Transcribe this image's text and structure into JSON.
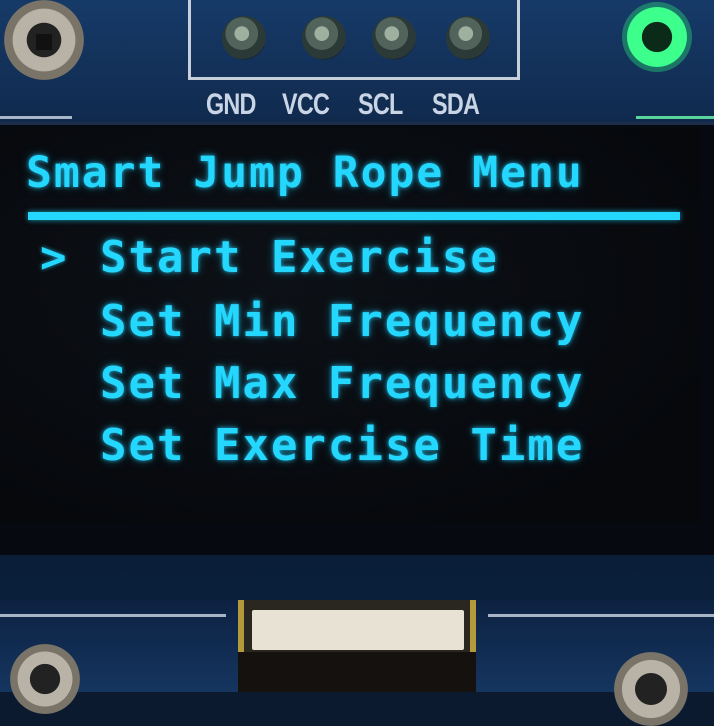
{
  "pins": {
    "labels": [
      "GND",
      "VCC",
      "SCL",
      "SDA"
    ]
  },
  "menu": {
    "title": "Smart Jump Rope Menu",
    "cursor": ">",
    "selected_index": 0,
    "items": [
      {
        "label": "Start Exercise"
      },
      {
        "label": "Set Min Frequency"
      },
      {
        "label": "Set Max Frequency"
      },
      {
        "label": "Set Exercise Time"
      }
    ]
  },
  "colors": {
    "oled_text": "#24d7ff",
    "pcb": "#10294c",
    "led_glow": "#3cff8c"
  }
}
